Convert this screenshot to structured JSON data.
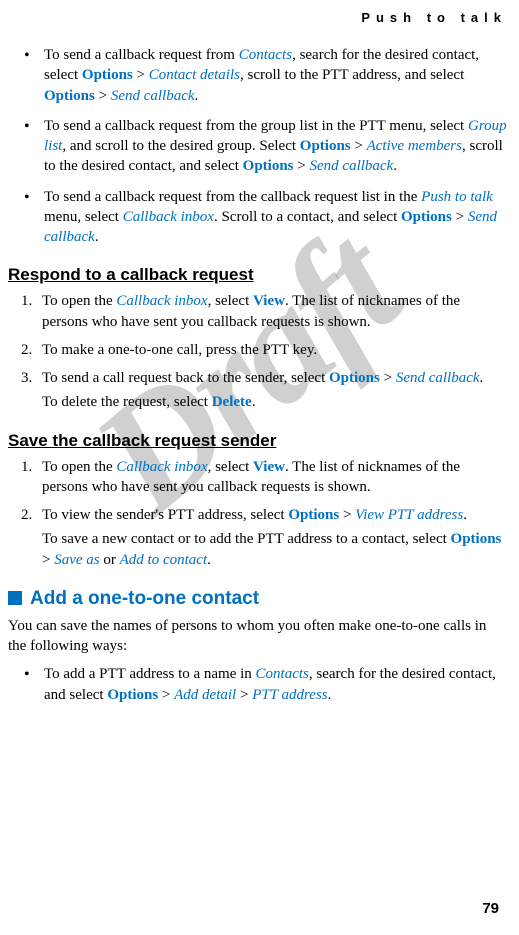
{
  "header": {
    "running_title": "Push to talk"
  },
  "watermark": "Draft",
  "page_number": "79",
  "terms": {
    "contacts": "Contacts",
    "options": "Options",
    "contact_details": "Contact details",
    "send_callback": "Send callback",
    "group_list": "Group list",
    "active_members": "Active members",
    "push_to_talk": "Push to talk",
    "callback_inbox": "Callback inbox",
    "view": "View",
    "delete": "Delete",
    "view_ptt_address": "View PTT address",
    "save_as": "Save as",
    "add_to_contact": "Add to contact",
    "add_detail": "Add detail",
    "ptt_address": "PTT address",
    "gt": ">"
  },
  "bullets_top": {
    "b1": {
      "p1": "To send a callback request from ",
      "p2": ", search for the desired contact, select ",
      "p3": ", scroll to the PTT address, and select ",
      "p4": "."
    },
    "b2": {
      "p1": "To send a callback request from the group list in the PTT menu, select ",
      "p2": ", and scroll to the desired group. Select ",
      "p3": ", scroll to the desired contact, and select ",
      "p4": "."
    },
    "b3": {
      "p1": "To send a callback request from the callback request list in the ",
      "p2": " menu, select ",
      "p3": ". Scroll to a contact, and select ",
      "p4": "."
    }
  },
  "subheadings": {
    "respond": "Respond to a callback request",
    "save_sender": "Save the callback request sender"
  },
  "respond_steps": {
    "s1": {
      "p1": "To open the ",
      "p2": ", select ",
      "p3": ". The list of nicknames of the persons who have sent you callback requests is shown."
    },
    "s2": {
      "p1": "To make a one-to-one call, press the PTT key."
    },
    "s3": {
      "p1": "To send a call request back to the sender, select ",
      "p2": ".",
      "delete_p1": "To delete the request, select ",
      "delete_p2": "."
    }
  },
  "save_steps": {
    "s1": {
      "p1": "To open the ",
      "p2": ", select ",
      "p3": ". The list of nicknames of the persons who have sent you callback requests is shown."
    },
    "s2": {
      "p1": "To view the sender's PTT address, select ",
      "p2": ".",
      "save_p1": "To save a new contact or to add the PTT address to a contact, select ",
      "save_or": " or ",
      "save_p2": "."
    }
  },
  "section_add": {
    "title": "Add a one-to-one contact",
    "intro": "You can save the names of persons to whom you often make one-to-one calls in the following ways:",
    "b1": {
      "p1": "To add a PTT address to a name in ",
      "p2": ", search for the desired contact, and select ",
      "p3": "."
    }
  }
}
